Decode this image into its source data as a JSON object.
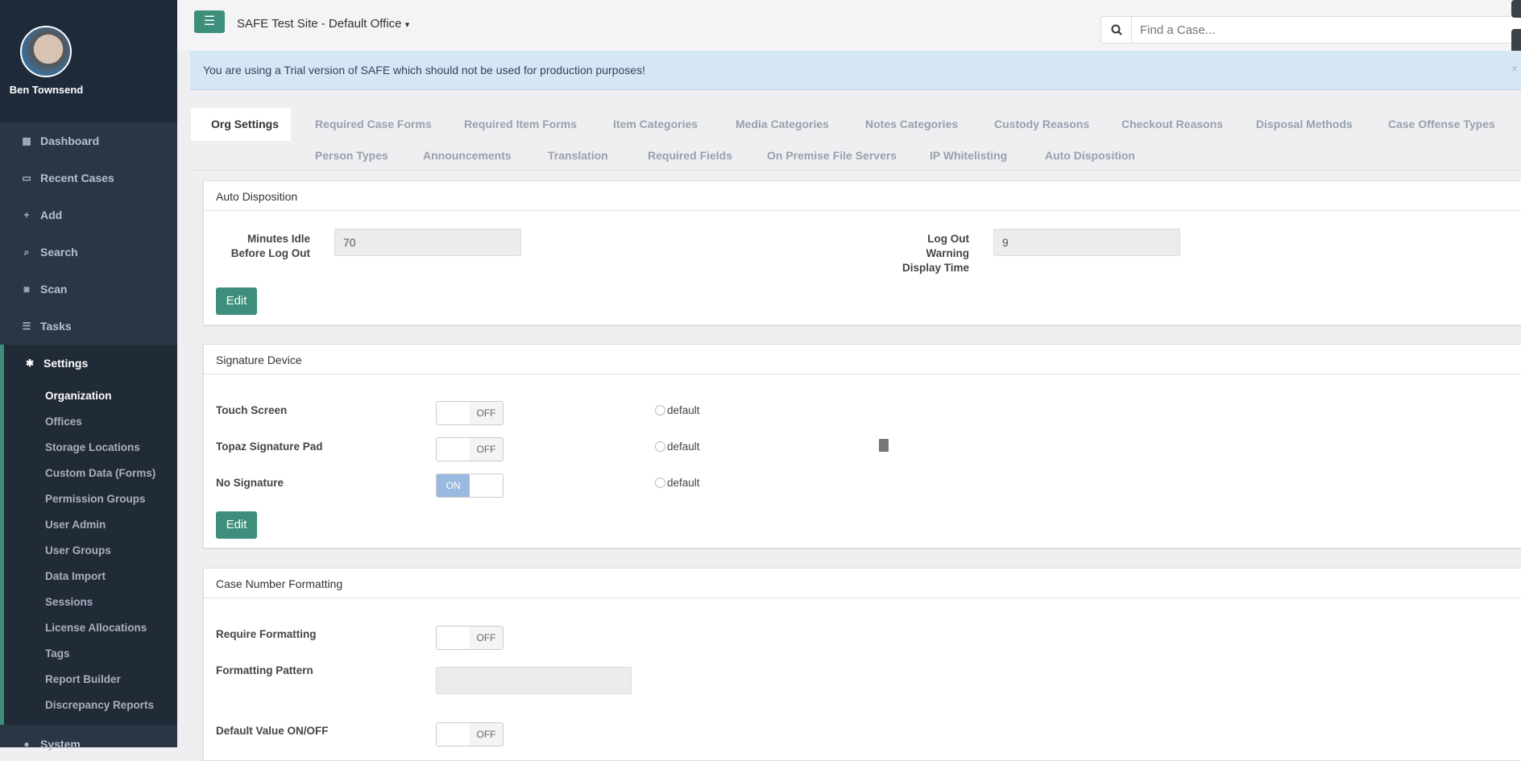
{
  "user": {
    "name": "Ben Townsend"
  },
  "nav": [
    {
      "label": "Dashboard",
      "icon": "dashboard-icon",
      "glyph": "▦"
    },
    {
      "label": "Recent Cases",
      "icon": "laptop-icon",
      "glyph": "▭"
    },
    {
      "label": "Add",
      "icon": "plus-icon",
      "glyph": "+"
    },
    {
      "label": "Search",
      "icon": "search-icon",
      "glyph": "⌕"
    },
    {
      "label": "Scan",
      "icon": "camera-icon",
      "glyph": "◙"
    },
    {
      "label": "Tasks",
      "icon": "tasks-icon",
      "glyph": "☰"
    }
  ],
  "settings": {
    "label": "Settings",
    "glyph": "✱",
    "items": [
      "Organization",
      "Offices",
      "Storage Locations",
      "Custom Data (Forms)",
      "Permission Groups",
      "User Admin",
      "User Groups",
      "Data Import",
      "Sessions",
      "License Allocations",
      "Tags",
      "Report Builder",
      "Discrepancy Reports"
    ]
  },
  "system": {
    "label": "System",
    "glyph": "●"
  },
  "header": {
    "menu_glyph": "☰",
    "site": "SAFE Test Site - Default Office",
    "caret": "▾",
    "search_placeholder": "Find a Case..."
  },
  "alert": {
    "text": "You are using a Trial version of SAFE which should not be used for production purposes!",
    "close": "×"
  },
  "tabs_row1": [
    "Org Settings",
    "Required Case Forms",
    "Required Item Forms",
    "Item Categories",
    "Media Categories",
    "Notes Categories",
    "Custody Reasons",
    "Checkout Reasons",
    "Disposal Methods",
    "Case Offense Types"
  ],
  "tabs_row2": [
    "Person Types",
    "Announcements",
    "Translation",
    "Required Fields",
    "On Premise File Servers",
    "IP Whitelisting",
    "Auto Disposition"
  ],
  "auto_disposition": {
    "title": "Auto Disposition",
    "idle_label1": "Minutes Idle",
    "idle_label2": "Before Log Out",
    "idle_value": "70",
    "warn_label1": "Log Out",
    "warn_label2": "Warning",
    "warn_label3": "Display Time",
    "warn_value": "9",
    "edit": "Edit"
  },
  "signature": {
    "title": "Signature Device",
    "rows": [
      {
        "label": "Touch Screen",
        "state": "OFF",
        "radio": "default"
      },
      {
        "label": "Topaz Signature Pad",
        "state": "OFF",
        "radio": "default"
      },
      {
        "label": "No Signature",
        "state": "ON",
        "radio": "default"
      }
    ],
    "edit": "Edit"
  },
  "case_format": {
    "title": "Case Number Formatting",
    "require_label": "Require Formatting",
    "require_state": "OFF",
    "pattern_label": "Formatting Pattern",
    "pattern_value": "",
    "default_label": "Default Value ON/OFF",
    "default_state": "OFF"
  }
}
